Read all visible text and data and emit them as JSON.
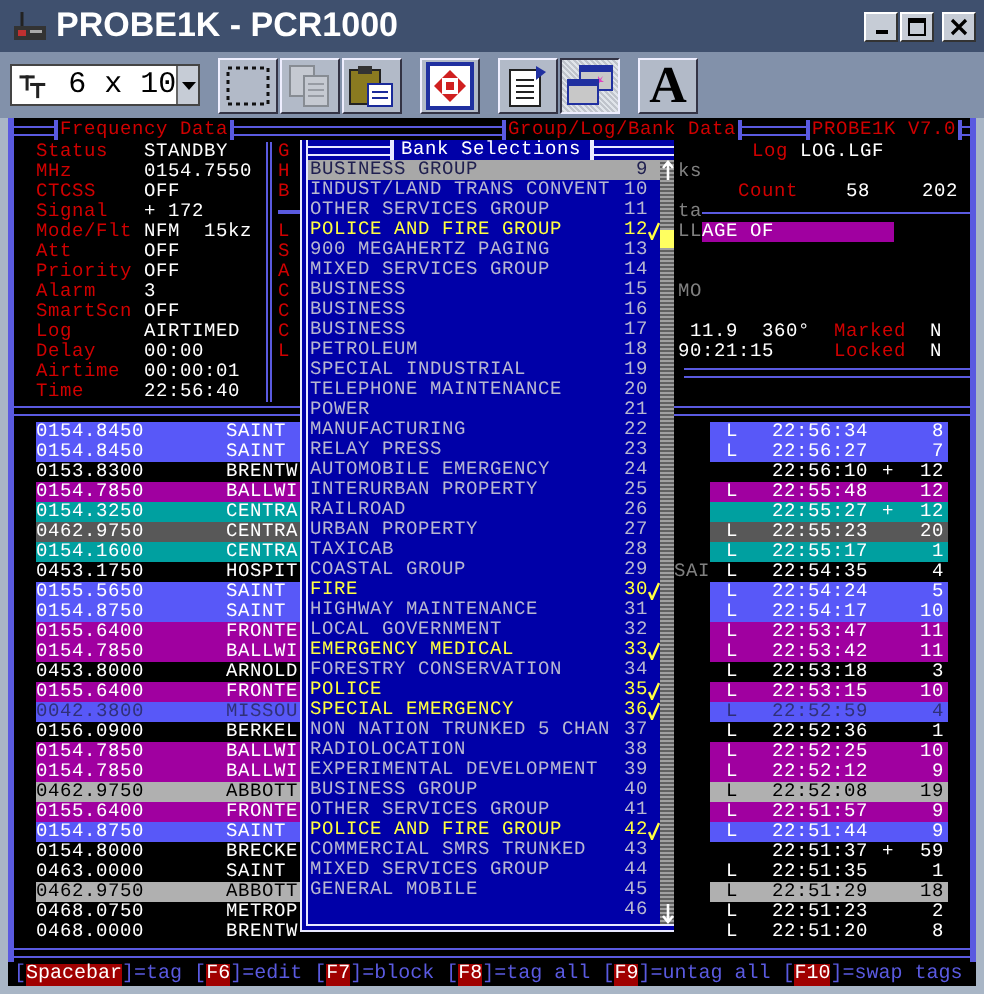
{
  "window": {
    "title": "PROBE1K - PCR1000"
  },
  "toolbar": {
    "font_size": "6 x 10",
    "buttons": [
      {
        "kind": "select",
        "disabled": false,
        "pressed": false
      },
      {
        "kind": "copy",
        "disabled": true,
        "pressed": false
      },
      {
        "kind": "paste",
        "disabled": false,
        "pressed": false
      },
      {
        "kind": "move",
        "disabled": false,
        "pressed": false
      },
      {
        "kind": "properties",
        "disabled": false,
        "pressed": false
      },
      {
        "kind": "window",
        "disabled": false,
        "pressed": true
      },
      {
        "kind": "font",
        "label": "A",
        "disabled": false,
        "pressed": false
      }
    ]
  },
  "frequency_data": {
    "title": "Frequency Data",
    "fields": [
      {
        "label": "Status",
        "value": "STANDBY"
      },
      {
        "label": "MHz",
        "value": "0154.7550"
      },
      {
        "label": "CTCSS",
        "value": "OFF"
      },
      {
        "label": "Signal",
        "value": "+ 172"
      },
      {
        "label": "Mode/Flt",
        "value": "NFM  15kz"
      },
      {
        "label": "Att",
        "value": "OFF"
      },
      {
        "label": "Priority",
        "value": "OFF"
      },
      {
        "label": "Alarm",
        "value": "3"
      },
      {
        "label": "SmartScn",
        "value": "OFF"
      },
      {
        "label": "Log",
        "value": "AIRTIMED"
      },
      {
        "label": "Delay",
        "value": "00:00"
      },
      {
        "label": "Airtime",
        "value": "00:00:01"
      },
      {
        "label": "Time",
        "value": "22:56:40"
      }
    ]
  },
  "group_data": {
    "title": "Group/Log/Bank Data",
    "fragments": [
      "G",
      "H",
      "B",
      "L",
      "S",
      "A",
      "C",
      "C",
      "C",
      "L"
    ]
  },
  "probe_panel": {
    "title": "PROBE1K V7.0",
    "log_label": "Log",
    "log_file": "LOG.LGF",
    "count_label": "Count",
    "count_1": "58",
    "count_2": "202",
    "message": "AGE OF",
    "reading_1": "11.9",
    "reading_2": "360°",
    "marked_label": "Marked",
    "marked": "N",
    "reading_3": "90:21:15",
    "locked_label": "Locked",
    "locked": "N",
    "fragments": [
      "ks",
      "ta",
      "LL",
      "MO"
    ]
  },
  "log_rows": [
    {
      "freq": "0154.8450",
      "name": "SAINT",
      "flag": "L",
      "time": "22:56:34",
      "count": "8",
      "color": "#5858f8",
      "dimmed": false
    },
    {
      "freq": "0154.8450",
      "name": "SAINT",
      "flag": "L",
      "time": "22:56:27",
      "count": "7",
      "color": "#5858f8",
      "dimmed": false
    },
    {
      "freq": "0153.8300",
      "name": "BRENTW",
      "time": "22:56:10",
      "mark": "+",
      "count": "12",
      "color": "#000000",
      "dimmed": false
    },
    {
      "freq": "0154.7850",
      "name": "BALLWI",
      "flag": "L",
      "time": "22:55:48",
      "count": "12",
      "color": "#a000a0",
      "dimmed": false
    },
    {
      "freq": "0154.3250",
      "name": "CENTRA",
      "time": "22:55:27",
      "mark": "+",
      "count": "12",
      "color": "#00a0a0",
      "dimmed": false
    },
    {
      "freq": "0462.9750",
      "name": "CENTRA",
      "flag": "L",
      "time": "22:55:23",
      "count": "20",
      "color": "#585858",
      "dimmed": false
    },
    {
      "freq": "0154.1600",
      "name": "CENTRA",
      "flag": "L",
      "time": "22:55:17",
      "count": "1",
      "color": "#00a0a0",
      "dimmed": false
    },
    {
      "freq": "0453.1750",
      "name": "HOSPIT",
      "fragment": "SAI",
      "flag": "L",
      "time": "22:54:35",
      "count": "4",
      "color": "#000000",
      "dimmed": false
    },
    {
      "freq": "0155.5650",
      "name": "SAINT",
      "flag": "L",
      "time": "22:54:24",
      "count": "5",
      "color": "#5858f8",
      "dimmed": false
    },
    {
      "freq": "0154.8750",
      "name": "SAINT",
      "flag": "L",
      "time": "22:54:17",
      "count": "10",
      "color": "#5858f8",
      "dimmed": false
    },
    {
      "freq": "0155.6400",
      "name": "FRONTE",
      "flag": "L",
      "time": "22:53:47",
      "count": "11",
      "color": "#a000a0",
      "dimmed": false
    },
    {
      "freq": "0154.7850",
      "name": "BALLWI",
      "flag": "L",
      "time": "22:53:42",
      "count": "11",
      "color": "#a000a0",
      "dimmed": false
    },
    {
      "freq": "0453.8000",
      "name": "ARNOLD",
      "flag": "L",
      "time": "22:53:18",
      "count": "3",
      "color": "#000000",
      "dimmed": false
    },
    {
      "freq": "0155.6400",
      "name": "FRONTE",
      "flag": "L",
      "time": "22:53:15",
      "count": "10",
      "color": "#a000a0",
      "dimmed": false
    },
    {
      "freq": "0042.3800",
      "name": "MISSOU",
      "flag": "L",
      "time": "22:52:59",
      "count": "4",
      "color": "#5858f8",
      "dimmed": true
    },
    {
      "freq": "0156.0900",
      "name": "BERKEL",
      "flag": "L",
      "time": "22:52:36",
      "count": "1",
      "color": "#000000",
      "dimmed": false
    },
    {
      "freq": "0154.7850",
      "name": "BALLWI",
      "flag": "L",
      "time": "22:52:25",
      "count": "10",
      "color": "#a000a0",
      "dimmed": false
    },
    {
      "freq": "0154.7850",
      "name": "BALLWI",
      "flag": "L",
      "time": "22:52:12",
      "count": "9",
      "color": "#a000a0",
      "dimmed": false
    },
    {
      "freq": "0462.9750",
      "name": "ABBOTT",
      "flag": "L",
      "time": "22:52:08",
      "count": "19",
      "color": "#b0b0b0",
      "dimmed": false
    },
    {
      "freq": "0155.6400",
      "name": "FRONTE",
      "flag": "L",
      "time": "22:51:57",
      "count": "9",
      "color": "#a000a0",
      "dimmed": false
    },
    {
      "freq": "0154.8750",
      "name": "SAINT",
      "flag": "L",
      "time": "22:51:44",
      "count": "9",
      "color": "#5858f8",
      "dimmed": false
    },
    {
      "freq": "0154.8000",
      "name": "BRECKE",
      "time": "22:51:37",
      "mark": "+",
      "count": "59",
      "color": "#000000",
      "dimmed": false
    },
    {
      "freq": "0463.0000",
      "name": "SAINT",
      "flag": "L",
      "time": "22:51:35",
      "count": "1",
      "color": "#000000",
      "dimmed": false
    },
    {
      "freq": "0462.9750",
      "name": "ABBOTT",
      "flag": "L",
      "time": "22:51:29",
      "count": "18",
      "color": "#b0b0b0",
      "dimmed": false
    },
    {
      "freq": "0468.0750",
      "name": "METROP",
      "flag": "L",
      "time": "22:51:23",
      "count": "2",
      "color": "#000000",
      "dimmed": false
    },
    {
      "freq": "0468.0000",
      "name": "BRENTW",
      "flag": "L",
      "time": "22:51:20",
      "count": "8",
      "color": "#000000",
      "dimmed": false
    }
  ],
  "bank_dialog": {
    "title": "Bank Selections",
    "items": [
      {
        "name": "BUSINESS GROUP",
        "number": "9",
        "checked": false,
        "selected": true
      },
      {
        "name": "INDUST/LAND TRANS CONVENT",
        "number": "10",
        "checked": false,
        "selected": false
      },
      {
        "name": "OTHER SERVICES GROUP",
        "number": "11",
        "checked": false,
        "selected": false
      },
      {
        "name": "POLICE AND FIRE GROUP",
        "number": "12",
        "checked": true,
        "selected": false
      },
      {
        "name": "900 MEGAHERTZ PAGING",
        "number": "13",
        "checked": false,
        "selected": false
      },
      {
        "name": "MIXED SERVICES GROUP",
        "number": "14",
        "checked": false,
        "selected": false
      },
      {
        "name": "BUSINESS",
        "number": "15",
        "checked": false,
        "selected": false
      },
      {
        "name": "BUSINESS",
        "number": "16",
        "checked": false,
        "selected": false
      },
      {
        "name": "BUSINESS",
        "number": "17",
        "checked": false,
        "selected": false
      },
      {
        "name": "PETROLEUM",
        "number": "18",
        "checked": false,
        "selected": false
      },
      {
        "name": "SPECIAL INDUSTRIAL",
        "number": "19",
        "checked": false,
        "selected": false
      },
      {
        "name": "TELEPHONE MAINTENANCE",
        "number": "20",
        "checked": false,
        "selected": false
      },
      {
        "name": "POWER",
        "number": "21",
        "checked": false,
        "selected": false
      },
      {
        "name": "MANUFACTURING",
        "number": "22",
        "checked": false,
        "selected": false
      },
      {
        "name": "RELAY PRESS",
        "number": "23",
        "checked": false,
        "selected": false
      },
      {
        "name": "AUTOMOBILE EMERGENCY",
        "number": "24",
        "checked": false,
        "selected": false
      },
      {
        "name": "INTERURBAN PROPERTY",
        "number": "25",
        "checked": false,
        "selected": false
      },
      {
        "name": "RAILROAD",
        "number": "26",
        "checked": false,
        "selected": false
      },
      {
        "name": "URBAN PROPERTY",
        "number": "27",
        "checked": false,
        "selected": false
      },
      {
        "name": "TAXICAB",
        "number": "28",
        "checked": false,
        "selected": false
      },
      {
        "name": "COASTAL GROUP",
        "number": "29",
        "checked": false,
        "selected": false
      },
      {
        "name": "FIRE",
        "number": "30",
        "checked": true,
        "selected": false
      },
      {
        "name": "HIGHWAY MAINTENANCE",
        "number": "31",
        "checked": false,
        "selected": false
      },
      {
        "name": "LOCAL GOVERNMENT",
        "number": "32",
        "checked": false,
        "selected": false
      },
      {
        "name": "EMERGENCY MEDICAL",
        "number": "33",
        "checked": true,
        "selected": false
      },
      {
        "name": "FORESTRY CONSERVATION",
        "number": "34",
        "checked": false,
        "selected": false
      },
      {
        "name": "POLICE",
        "number": "35",
        "checked": true,
        "selected": false
      },
      {
        "name": "SPECIAL EMERGENCY",
        "number": "36",
        "checked": true,
        "selected": false
      },
      {
        "name": "NON NATION TRUNKED 5 CHAN",
        "number": "37",
        "checked": false,
        "selected": false
      },
      {
        "name": "RADIOLOCATION",
        "number": "38",
        "checked": false,
        "selected": false
      },
      {
        "name": "EXPERIMENTAL DEVELOPMENT",
        "number": "39",
        "checked": false,
        "selected": false
      },
      {
        "name": "BUSINESS GROUP",
        "number": "40",
        "checked": false,
        "selected": false
      },
      {
        "name": "OTHER SERVICES GROUP",
        "number": "41",
        "checked": false,
        "selected": false
      },
      {
        "name": "POLICE AND FIRE GROUP",
        "number": "42",
        "checked": true,
        "selected": false
      },
      {
        "name": "COMMERCIAL SMRS TRUNKED",
        "number": "43",
        "checked": false,
        "selected": false
      },
      {
        "name": "MIXED SERVICES GROUP",
        "number": "44",
        "checked": false,
        "selected": false
      },
      {
        "name": "GENERAL MOBILE",
        "number": "45",
        "checked": false,
        "selected": false
      },
      {
        "number": "46",
        "checked": false,
        "selected": false
      }
    ]
  },
  "key_hints": [
    {
      "before": "[",
      "key": "Spacebar",
      "after": "]=tag"
    },
    {
      "before": "[",
      "key": "F6",
      "after": "]=edit"
    },
    {
      "before": "[",
      "key": "F7",
      "after": "]=block"
    },
    {
      "before": "[",
      "key": "F8",
      "after": "]=tag all"
    },
    {
      "before": "[",
      "key": "F9",
      "after": "]=untag all"
    },
    {
      "before": "[",
      "key": "F10",
      "after": "]=swap tags"
    }
  ]
}
